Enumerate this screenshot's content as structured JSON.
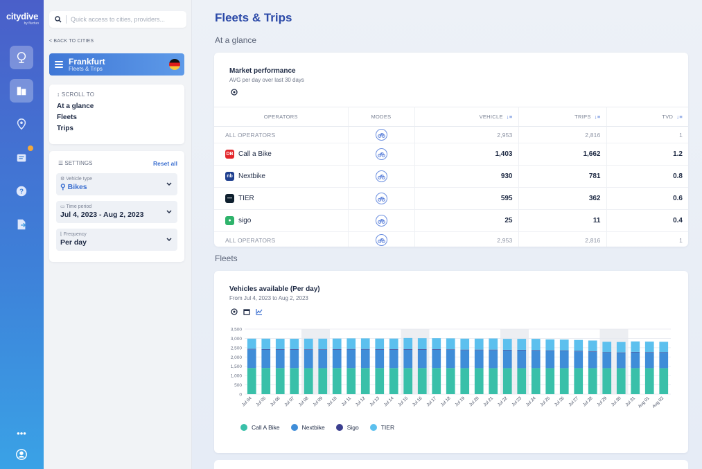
{
  "app": {
    "logo": "citydive",
    "logo_sub": "by fluctuo"
  },
  "rail": {
    "icons": [
      "globe-icon",
      "city-icon",
      "location-icon",
      "report-icon",
      "help-icon",
      "export-icon",
      "more-icon",
      "user-icon"
    ],
    "more_label": "•••"
  },
  "side": {
    "search_placeholder": "Quick access to cities, providers...",
    "back_label": "< BACK TO CITIES",
    "city": {
      "name": "Frankfurt",
      "subtitle": "Fleets & Trips"
    },
    "scroll_to": {
      "header": "SCROLL TO",
      "items": [
        "At a glance",
        "Fleets",
        "Trips"
      ]
    },
    "settings": {
      "header": "SETTINGS",
      "reset": "Reset all",
      "vehicle_type": {
        "label": "Vehicle type",
        "value": "Bikes"
      },
      "time_period": {
        "label": "Time period",
        "value": "Jul 4, 2023 - Aug 2, 2023"
      },
      "frequency": {
        "label": "Frequency",
        "value": "Per day"
      }
    }
  },
  "main": {
    "title": "Fleets & Trips",
    "section1": "At a glance",
    "section2": "Fleets",
    "market": {
      "title": "Market performance",
      "subtitle": "AVG per day over last 30 days",
      "columns": {
        "operators": "OPERATORS",
        "modes": "MODES",
        "vehicle": "VEHICLE",
        "trips": "TRIPS",
        "tvd": "TVD"
      },
      "rows": [
        {
          "operator": "ALL OPERATORS",
          "vehicle": "2,953",
          "trips": "2,816",
          "tvd": "1",
          "agg": true
        },
        {
          "operator": "Call a Bike",
          "vehicle": "1,403",
          "trips": "1,662",
          "tvd": "1.2",
          "color": "#e3262b",
          "glyph": "DB"
        },
        {
          "operator": "Nextbike",
          "vehicle": "930",
          "trips": "781",
          "tvd": "0.8",
          "color": "#1f3f8f",
          "glyph": "nb"
        },
        {
          "operator": "TIER",
          "vehicle": "595",
          "trips": "362",
          "tvd": "0.6",
          "color": "#0e1f2e",
          "glyph": "—"
        },
        {
          "operator": "sigo",
          "vehicle": "25",
          "trips": "11",
          "tvd": "0.4",
          "color": "#2fb36b",
          "glyph": "●"
        },
        {
          "operator": "ALL OPERATORS",
          "vehicle": "2,953",
          "trips": "2,816",
          "tvd": "1",
          "agg": true
        }
      ]
    },
    "vehicles": {
      "title": "Vehicles available (Per day)",
      "subtitle": "From Jul 4, 2023 to Aug 2, 2023"
    }
  },
  "chart_data": {
    "type": "bar",
    "stacked": true,
    "categories": [
      "Jul 04",
      "Jul 05",
      "Jul 06",
      "Jul 07",
      "Jul 08",
      "Jul 09",
      "Jul 10",
      "Jul 11",
      "Jul 12",
      "Jul 13",
      "Jul 14",
      "Jul 15",
      "Jul 16",
      "Jul 17",
      "Jul 18",
      "Jul 19",
      "Jul 20",
      "Jul 21",
      "Jul 22",
      "Jul 23",
      "Jul 24",
      "Jul 25",
      "Jul 26",
      "Jul 27",
      "Jul 28",
      "Jul 29",
      "Jul 30",
      "Jul 31",
      "Aug 01",
      "Aug 02"
    ],
    "series": [
      {
        "name": "Call A Bike",
        "color": "#39c0a9",
        "values": [
          1410,
          1410,
          1405,
          1405,
          1400,
          1400,
          1405,
          1405,
          1405,
          1405,
          1405,
          1405,
          1405,
          1405,
          1405,
          1400,
          1400,
          1400,
          1400,
          1400,
          1400,
          1400,
          1400,
          1400,
          1400,
          1400,
          1400,
          1400,
          1400,
          1400
        ]
      },
      {
        "name": "Nextbike",
        "color": "#3f8dd8",
        "values": [
          1000,
          990,
          990,
          990,
          990,
          990,
          990,
          1000,
          1000,
          990,
          990,
          990,
          990,
          990,
          980,
          970,
          970,
          970,
          960,
          960,
          950,
          930,
          920,
          900,
          880,
          830,
          820,
          850,
          840,
          830
        ]
      },
      {
        "name": "Sigo",
        "color": "#3b3f8f",
        "values": [
          25,
          25,
          25,
          25,
          25,
          25,
          25,
          25,
          25,
          25,
          25,
          25,
          25,
          25,
          25,
          25,
          25,
          25,
          25,
          25,
          25,
          25,
          25,
          25,
          25,
          25,
          25,
          25,
          25,
          25
        ]
      },
      {
        "name": "TIER",
        "color": "#5cc0ee",
        "values": [
          550,
          560,
          560,
          560,
          570,
          570,
          570,
          570,
          570,
          570,
          570,
          600,
          590,
          590,
          590,
          590,
          590,
          600,
          590,
          590,
          600,
          590,
          590,
          590,
          580,
          560,
          560,
          560,
          560,
          560
        ]
      }
    ],
    "ylim": [
      0,
      3500
    ],
    "yticks": [
      "3,500",
      "3,000",
      "2,500",
      "2,000",
      "1,500",
      "1,000",
      "500",
      "0"
    ],
    "weekend_highlights": [
      4,
      5,
      11,
      12,
      18,
      19,
      25,
      26
    ]
  }
}
